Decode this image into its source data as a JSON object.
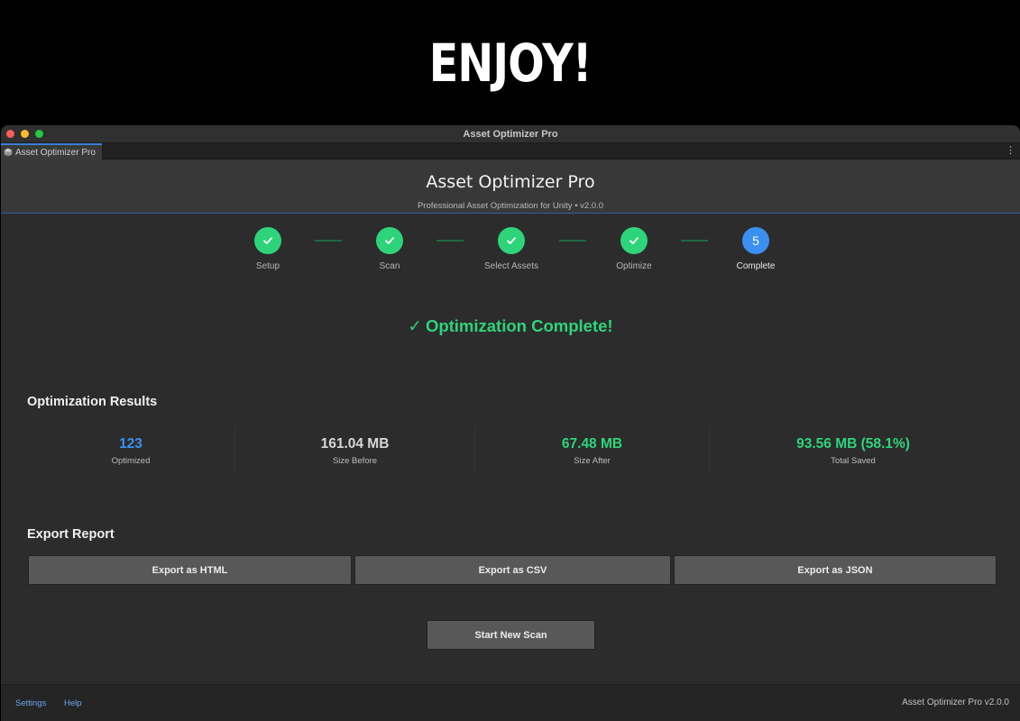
{
  "banner": {
    "text": "ENJOY!"
  },
  "window": {
    "title": "Asset Optimizer Pro",
    "tab_label": "Asset Optimizer Pro",
    "tab_icon": "cube-icon",
    "more_icon": "more-vertical-icon"
  },
  "header": {
    "title": "Asset Optimizer Pro",
    "subtitle": "Professional Asset Optimization for Unity • v2.0.0"
  },
  "steps": [
    {
      "label": "Setup",
      "state": "done",
      "icon": "check-icon"
    },
    {
      "label": "Scan",
      "state": "done",
      "icon": "check-icon"
    },
    {
      "label": "Select Assets",
      "state": "done",
      "icon": "check-icon"
    },
    {
      "label": "Optimize",
      "state": "done",
      "icon": "check-icon"
    },
    {
      "label": "Complete",
      "state": "current",
      "number": "5"
    }
  ],
  "status": {
    "message": "Optimization Complete!",
    "check_glyph": "✓"
  },
  "results": {
    "title": "Optimization Results",
    "stats": [
      {
        "value": "123",
        "label": "Optimized",
        "color": "#3b8ff0"
      },
      {
        "value": "161.04 MB",
        "label": "Size Before",
        "color": "#d8d8d8"
      },
      {
        "value": "67.48 MB",
        "label": "Size After",
        "color": "#2ed47a"
      },
      {
        "value": "93.56 MB (58.1%)",
        "label": "Total Saved",
        "color": "#2ed47a"
      }
    ]
  },
  "export": {
    "title": "Export Report",
    "html_label": "Export as HTML",
    "csv_label": "Export as CSV",
    "json_label": "Export as JSON"
  },
  "actions": {
    "new_scan_label": "Start New Scan"
  },
  "footer": {
    "settings_label": "Settings",
    "help_label": "Help",
    "version": "Asset Optimizer Pro v2.0.0"
  },
  "colors": {
    "accent_green": "#2ed47a",
    "accent_blue": "#3b8ff0",
    "link": "#68a7ef"
  }
}
